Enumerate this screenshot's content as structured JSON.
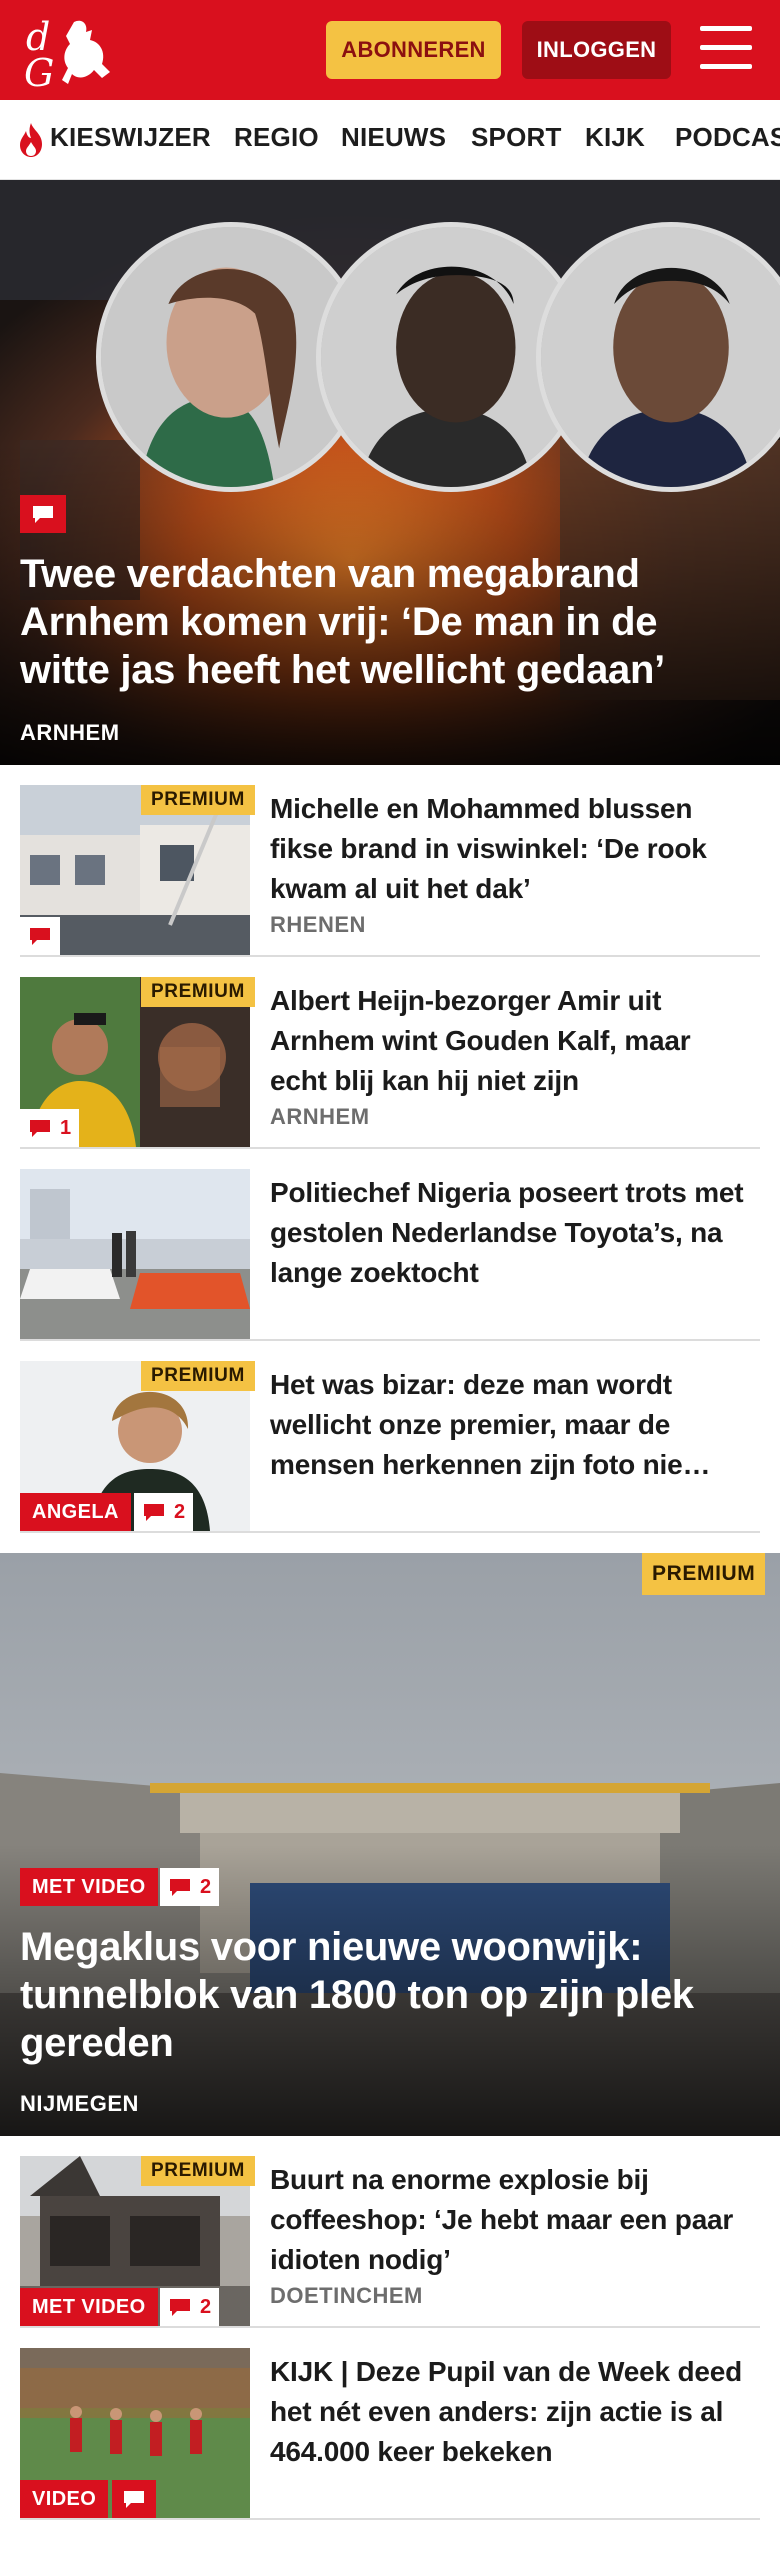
{
  "brand": {
    "logo_text": "dG",
    "primary_color": "#d9101e",
    "accent_color": "#f4c243"
  },
  "header": {
    "subscribe_label": "ABONNEREN",
    "login_label": "INLOGGEN",
    "menu_icon": "hamburger-icon"
  },
  "nav": {
    "items": [
      {
        "label": "KIESWIJZER",
        "icon": "flame-icon"
      },
      {
        "label": "REGIO"
      },
      {
        "label": "NIEUWS"
      },
      {
        "label": "SPORT"
      },
      {
        "label": "KIJK"
      },
      {
        "label": "PODCAS"
      }
    ]
  },
  "hero": {
    "title": "Twee verdachten van megabrand Arnhem komen vrij: ‘De man in de witte jas heeft het wellicht gedaan’",
    "location": "ARNHEM",
    "comment_icon": "comment-icon"
  },
  "articles": [
    {
      "title": "Michelle en Mohammed blussen fikse brand in viswinkel: ‘De rook kwam al uit het dak’",
      "location": "RHENEN",
      "premium": "PREMIUM",
      "comments": ""
    },
    {
      "title": "Albert Heijn-bezorger Amir uit Arnhem wint Gouden Kalf, maar echt blij kan hij niet zijn",
      "location": "ARNHEM",
      "premium": "PREMIUM",
      "comments": "1"
    },
    {
      "title": "Politiechef Nigeria poseert trots met gestolen Nederlandse Toyota’s, na lange zoektocht",
      "location": "",
      "premium": "",
      "comments": ""
    },
    {
      "title": "Het was bizar: deze man wordt wellicht onze premier, maar de mensen herkennen zijn foto nie…",
      "location": "",
      "premium": "PREMIUM",
      "tag": "ANGELA",
      "comments": "2"
    }
  ],
  "video_hero": {
    "premium": "PREMIUM",
    "tag": "MET VIDEO",
    "comments": "2",
    "title": "Megaklus voor nieuwe woonwijk: tunnelblok van 1800 ton op zijn plek gereden",
    "location": "NIJMEGEN"
  },
  "articles2": [
    {
      "title": "Buurt na enorme explosie bij coffeeshop: ‘Je hebt maar een paar idioten nodig’",
      "location": "DOETINCHEM",
      "premium": "PREMIUM",
      "tag": "MET VIDEO",
      "comments": "2"
    },
    {
      "title": "KIJK | Deze Pupil van de Week deed het nét even anders: zijn actie is al 464.000 keer bekeken",
      "location": "",
      "premium": "",
      "tag": "VIDEO",
      "comments": ""
    }
  ]
}
